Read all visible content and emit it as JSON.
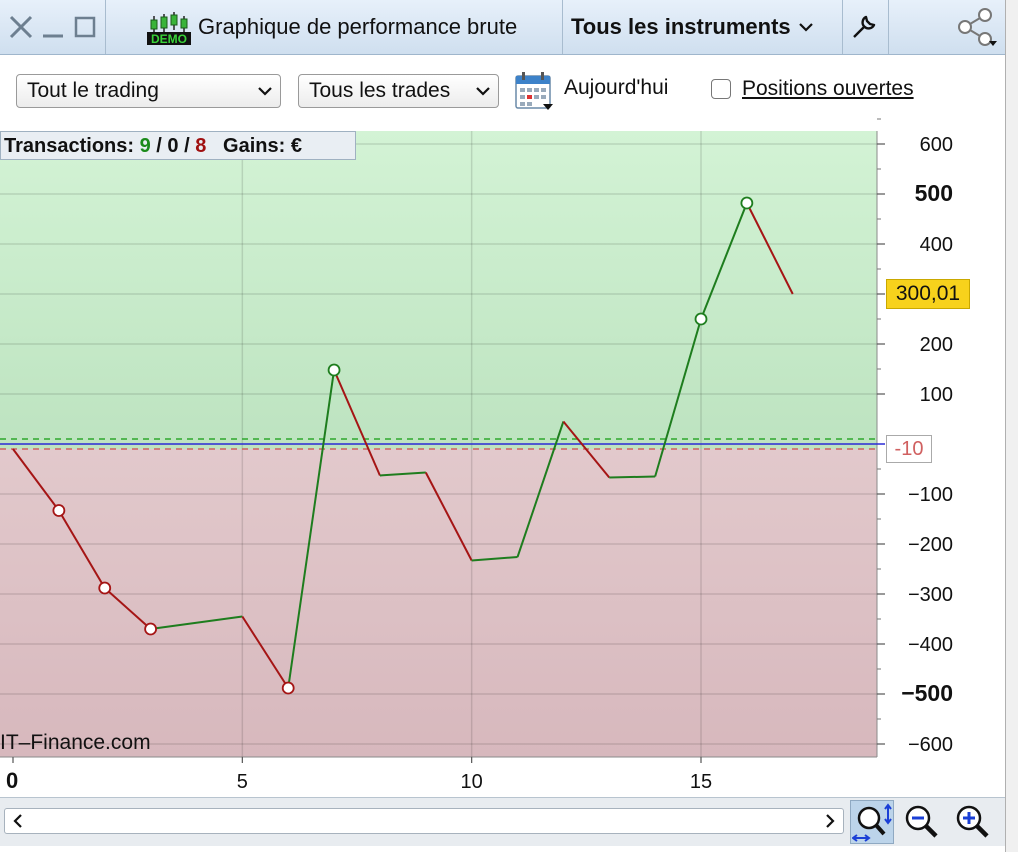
{
  "titlebar": {
    "title": "Graphique de performance brute",
    "demo_badge": "DEMO",
    "instruments": "Tous les instruments"
  },
  "toolbar": {
    "trading_filter": "Tout le trading",
    "trades_filter": "Tous les trades",
    "date_label": "Aujourd'hui",
    "positions_label": "Positions ouvertes",
    "positions_checked": false
  },
  "stats": {
    "transactions_label": "Transactions:",
    "wins": "9",
    "sep1": "/",
    "neutral": "0",
    "sep2": "/",
    "losses": "8",
    "gains_label": "Gains:",
    "currency": "€"
  },
  "chart": {
    "watermark": "IT–Finance.com",
    "current_value_label": "300,01",
    "zero_marker_label": "-10",
    "x_tick_labels": [
      "0",
      "5",
      "10",
      "15"
    ],
    "y_tick_labels": [
      "600",
      "500",
      "400",
      "300",
      "200",
      "100",
      "-100",
      "-200",
      "-300",
      "-400",
      "-500",
      "-600"
    ]
  },
  "chart_data": {
    "type": "line",
    "x": [
      0,
      1,
      2,
      3,
      5,
      6,
      7,
      8,
      9,
      10,
      11,
      12,
      13,
      14,
      15,
      16,
      17
    ],
    "y": [
      -10,
      -133,
      -288,
      -370,
      -345,
      -488,
      148,
      -63,
      -57,
      -233,
      -226,
      45,
      -67,
      -65,
      250,
      482,
      300
    ],
    "markers": [
      false,
      true,
      true,
      true,
      false,
      true,
      true,
      false,
      false,
      false,
      false,
      false,
      false,
      false,
      true,
      true,
      false
    ],
    "xlim": [
      0,
      19
    ],
    "ylim": [
      -630,
      630
    ],
    "zero_line": -10,
    "y_major_ticks": [
      600,
      500,
      400,
      300,
      200,
      100,
      -100,
      -200,
      -300,
      -400,
      -500,
      -600
    ],
    "y_bold_ticks": [
      500,
      -500
    ],
    "x_ticks": [
      0,
      5,
      10,
      15
    ],
    "grid": true,
    "up_color": "#1e7d1e",
    "down_color": "#a51515",
    "profit_zone_color": "#c8ecca",
    "loss_zone_color": "#dcbfc3"
  },
  "colors": {
    "titlebar": "#d8e6f4",
    "current_value_bg": "#f7d21c",
    "zero_line": "#2b2bd6"
  },
  "icons": [
    "close-icon",
    "minimize-icon",
    "maximize-icon",
    "demo-candles-icon",
    "chevron-down-icon",
    "wrench-icon",
    "share-icon",
    "calendar-icon",
    "zoom-fit-icon",
    "zoom-out-icon",
    "zoom-in-icon"
  ]
}
